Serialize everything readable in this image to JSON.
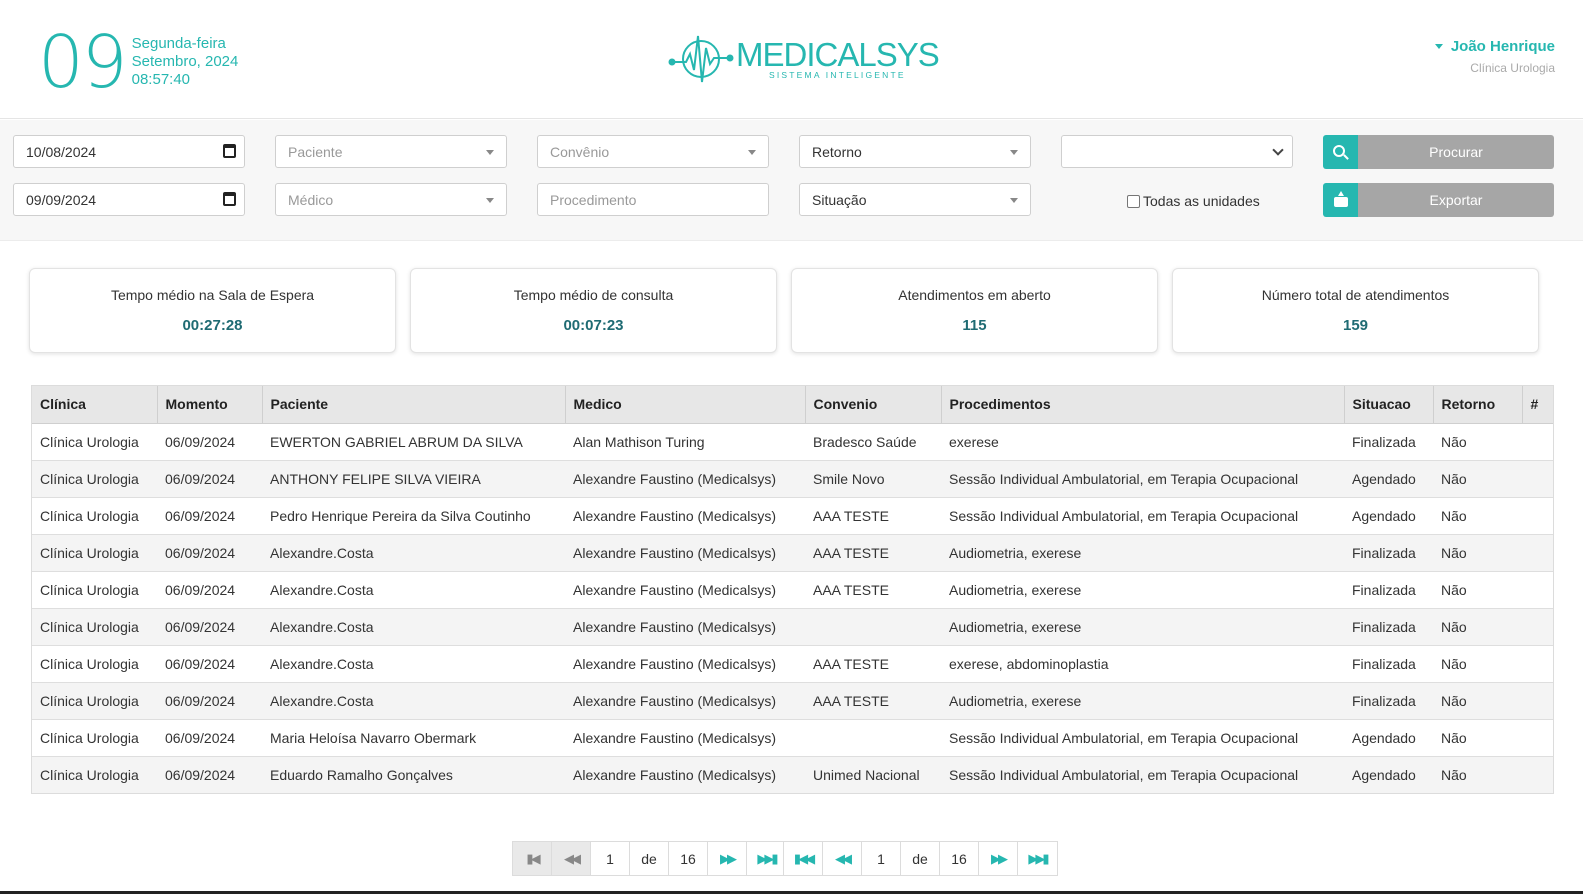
{
  "header": {
    "day": "09",
    "weekday": "Segunda-feira",
    "month_year": "Setembro, 2024",
    "time": "08:57:40",
    "logo_main": "MEDICALSYS",
    "logo_sub": "SISTEMA INTELIGENTE",
    "user_name": "João Henrique",
    "user_clinic": "Clínica Urologia"
  },
  "filters": {
    "date_start": "10/08/2024",
    "date_end": "09/09/2024",
    "paciente_placeholder": "Paciente",
    "medico_placeholder": "Médico",
    "convenio_placeholder": "Convênio",
    "procedimento_placeholder": "Procedimento",
    "retorno_value": "Retorno",
    "situacao_value": "Situação",
    "unit_select_value": "",
    "all_units_label": "Todas as unidades",
    "search_label": "Procurar",
    "export_label": "Exportar"
  },
  "stats": [
    {
      "label": "Tempo médio na Sala de Espera",
      "value": "00:27:28"
    },
    {
      "label": "Tempo médio de consulta",
      "value": "00:07:23"
    },
    {
      "label": "Atendimentos em aberto",
      "value": "115"
    },
    {
      "label": "Número total de atendimentos",
      "value": "159"
    }
  ],
  "table": {
    "columns": [
      "Clínica",
      "Momento",
      "Paciente",
      "Medico",
      "Convenio",
      "Procedimentos",
      "Situacao",
      "Retorno",
      "#"
    ],
    "rows": [
      [
        "Clínica Urologia",
        "06/09/2024",
        "EWERTON GABRIEL ABRUM DA SILVA",
        "Alan Mathison Turing",
        "Bradesco Saúde",
        "exerese",
        "Finalizada",
        "Não",
        ""
      ],
      [
        "Clínica Urologia",
        "06/09/2024",
        "ANTHONY FELIPE SILVA VIEIRA",
        "Alexandre Faustino (Medicalsys)",
        "Smile Novo",
        "Sessão Individual Ambulatorial, em Terapia Ocupacional",
        "Agendado",
        "Não",
        ""
      ],
      [
        "Clínica Urologia",
        "06/09/2024",
        "Pedro Henrique Pereira da Silva Coutinho",
        "Alexandre Faustino (Medicalsys)",
        "AAA TESTE",
        "Sessão Individual Ambulatorial, em Terapia Ocupacional",
        "Agendado",
        "Não",
        ""
      ],
      [
        "Clínica Urologia",
        "06/09/2024",
        "Alexandre.Costa",
        "Alexandre Faustino (Medicalsys)",
        "AAA TESTE",
        "Audiometria, exerese",
        "Finalizada",
        "Não",
        ""
      ],
      [
        "Clínica Urologia",
        "06/09/2024",
        "Alexandre.Costa",
        "Alexandre Faustino (Medicalsys)",
        "AAA TESTE",
        "Audiometria, exerese",
        "Finalizada",
        "Não",
        ""
      ],
      [
        "Clínica Urologia",
        "06/09/2024",
        "Alexandre.Costa",
        "Alexandre Faustino (Medicalsys)",
        "",
        "Audiometria, exerese",
        "Finalizada",
        "Não",
        ""
      ],
      [
        "Clínica Urologia",
        "06/09/2024",
        "Alexandre.Costa",
        "Alexandre Faustino (Medicalsys)",
        "AAA TESTE",
        "exerese, abdominoplastia",
        "Finalizada",
        "Não",
        ""
      ],
      [
        "Clínica Urologia",
        "06/09/2024",
        "Alexandre.Costa",
        "Alexandre Faustino (Medicalsys)",
        "AAA TESTE",
        "Audiometria, exerese",
        "Finalizada",
        "Não",
        ""
      ],
      [
        "Clínica Urologia",
        "06/09/2024",
        "Maria Heloísa Navarro Obermark",
        "Alexandre Faustino (Medicalsys)",
        "",
        "Sessão Individual Ambulatorial, em Terapia Ocupacional",
        "Agendado",
        "Não",
        ""
      ],
      [
        "Clínica Urologia",
        "06/09/2024",
        "Eduardo Ramalho Gonçalves",
        "Alexandre Faustino (Medicalsys)",
        "Unimed Nacional",
        "Sessão Individual Ambulatorial, em Terapia Ocupacional",
        "Agendado",
        "Não",
        ""
      ]
    ]
  },
  "pagination": {
    "current": "1",
    "of": "de",
    "total": "16"
  },
  "colors": {
    "accent": "#26b7b0",
    "stat_value": "#1f6b73",
    "button_gray": "#a6a6a6"
  }
}
